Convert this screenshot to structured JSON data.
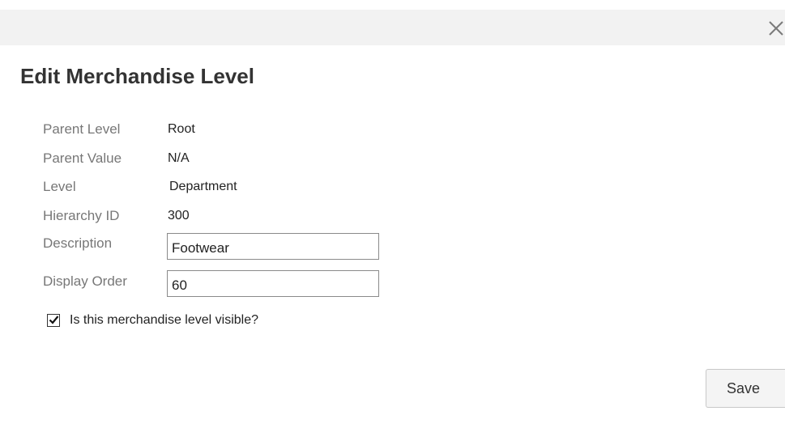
{
  "dialog": {
    "title": "Edit Merchandise Level",
    "close_icon": "close-icon"
  },
  "form": {
    "parent_level": {
      "label": "Parent Level",
      "value": "Root"
    },
    "parent_value": {
      "label": "Parent Value",
      "value": "N/A"
    },
    "level": {
      "label": "Level",
      "value": "Department"
    },
    "hierarchy_id": {
      "label": "Hierarchy ID",
      "value": "300"
    },
    "description": {
      "label": "Description",
      "value": "Footwear"
    },
    "display_order": {
      "label": "Display Order",
      "value": "60"
    },
    "visible": {
      "label": "Is this merchandise level visible?",
      "checked": true
    }
  },
  "actions": {
    "save_label": "Save"
  },
  "colors": {
    "title_bar": "#f2f2f2",
    "label_text": "#777777",
    "value_text": "#222222",
    "title_text": "#333333"
  }
}
